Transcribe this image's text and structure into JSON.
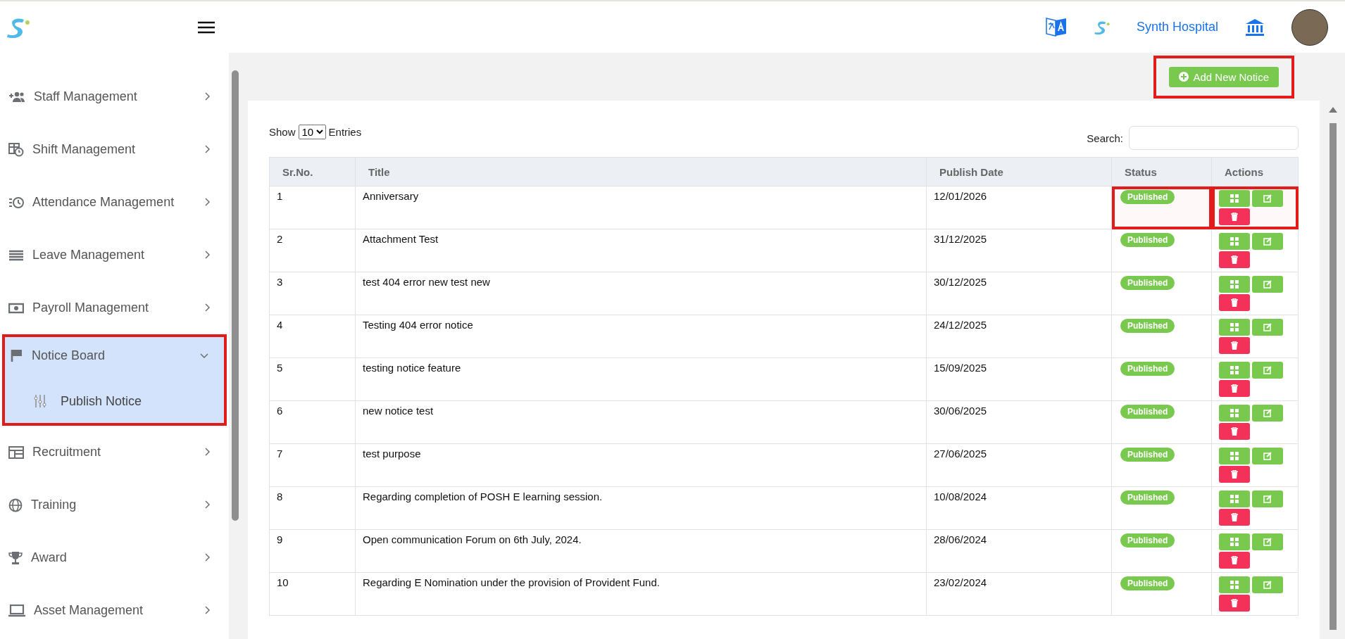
{
  "header": {
    "hospital_name": "Synth Hospital"
  },
  "sidebar": {
    "items": [
      {
        "label": "Staff Management",
        "selected": false,
        "expanded": false,
        "highlighted": false
      },
      {
        "label": "Shift Management",
        "selected": false,
        "expanded": false,
        "highlighted": false
      },
      {
        "label": "Attendance Management",
        "selected": false,
        "expanded": false,
        "highlighted": false
      },
      {
        "label": "Leave Management",
        "selected": false,
        "expanded": false,
        "highlighted": false
      },
      {
        "label": "Payroll Management",
        "selected": false,
        "expanded": false,
        "highlighted": false
      },
      {
        "label": "Notice Board",
        "selected": true,
        "expanded": true,
        "highlighted": true,
        "children": [
          {
            "label": "Publish Notice",
            "selected": true
          }
        ]
      },
      {
        "label": "Recruitment",
        "selected": false,
        "expanded": false,
        "highlighted": false
      },
      {
        "label": "Training",
        "selected": false,
        "expanded": false,
        "highlighted": false
      },
      {
        "label": "Award",
        "selected": false,
        "expanded": false,
        "highlighted": false
      },
      {
        "label": "Asset Management",
        "selected": false,
        "expanded": false,
        "highlighted": false
      }
    ]
  },
  "add_button": {
    "label": "Add New Notice",
    "highlighted": true
  },
  "table_controls": {
    "show_label": "Show",
    "page_size": "10",
    "entries_label": "Entries",
    "search_label": "Search:"
  },
  "table": {
    "columns": [
      "Sr.No.",
      "Title",
      "Publish Date",
      "Status",
      "Actions"
    ],
    "rows": [
      {
        "sr": "1",
        "title": "Anniversary",
        "date": "12/01/2026",
        "status": "Published",
        "highlighted": true
      },
      {
        "sr": "2",
        "title": "Attachment Test",
        "date": "31/12/2025",
        "status": "Published",
        "highlighted": false
      },
      {
        "sr": "3",
        "title": "test 404 error new test new",
        "date": "30/12/2025",
        "status": "Published",
        "highlighted": false
      },
      {
        "sr": "4",
        "title": "Testing 404 error notice",
        "date": "24/12/2025",
        "status": "Published",
        "highlighted": false
      },
      {
        "sr": "5",
        "title": "testing notice feature",
        "date": "15/09/2025",
        "status": "Published",
        "highlighted": false
      },
      {
        "sr": "6",
        "title": "new notice test",
        "date": "30/06/2025",
        "status": "Published",
        "highlighted": false
      },
      {
        "sr": "7",
        "title": "test purpose",
        "date": "27/06/2025",
        "status": "Published",
        "highlighted": false
      },
      {
        "sr": "8",
        "title": "Regarding completion of POSH E learning session.",
        "date": "10/08/2024",
        "status": "Published",
        "highlighted": false
      },
      {
        "sr": "9",
        "title": "Open communication Forum on 6th July, 2024.",
        "date": "28/06/2024",
        "status": "Published",
        "highlighted": false
      },
      {
        "sr": "10",
        "title": "Regarding E Nomination under the provision of Provident Fund.",
        "date": "23/02/2024",
        "status": "Published",
        "highlighted": false
      }
    ]
  }
}
